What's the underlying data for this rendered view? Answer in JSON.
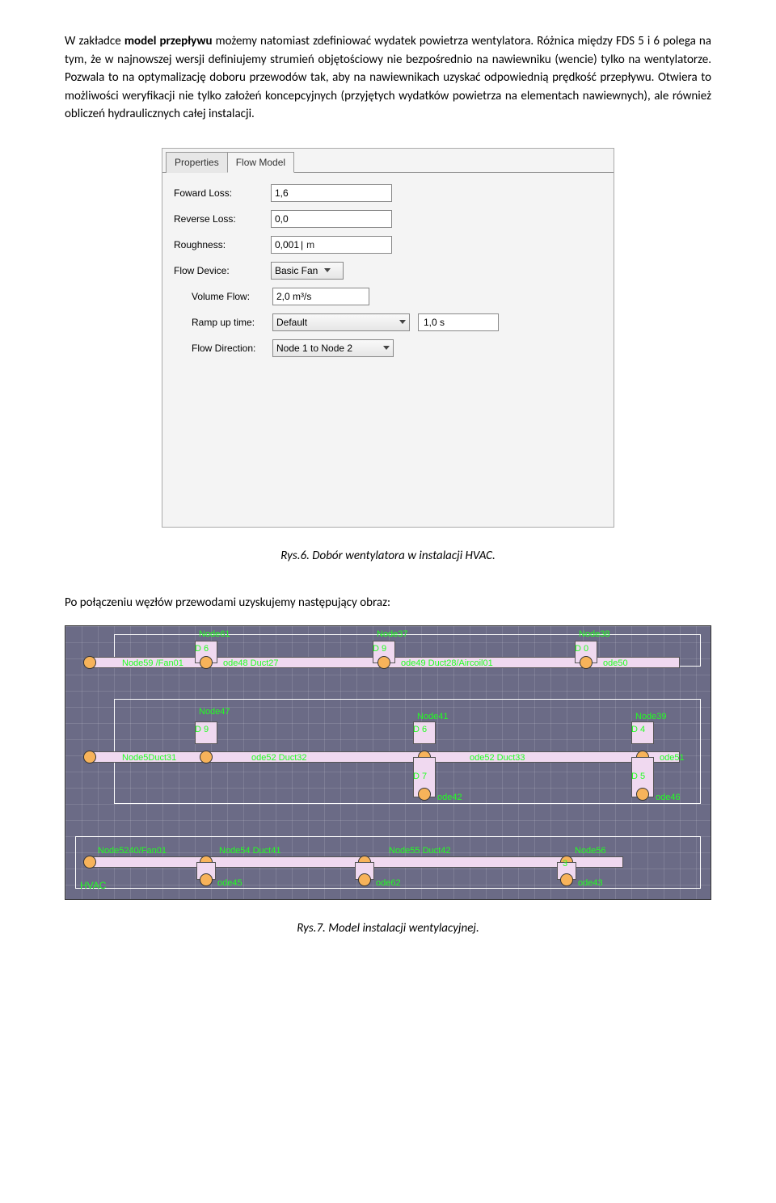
{
  "para1": {
    "pre": "W zakładce ",
    "b1": "model przepływu",
    "rest": " możemy natomiast zdefiniować wydatek powietrza wentylatora. Różnica między FDS 5 i 6 polega na tym, że w najnowszej wersji definiujemy strumień objętościowy nie bezpośrednio na nawiewniku (wencie) tylko na wentylatorze. Pozwala to na optymalizację doboru przewodów tak, aby na nawiewnikach uzyskać odpowiednią prędkość przepływu. Otwiera to możliwości weryfikacji nie tylko założeń koncepcyjnych (przyjętych wydatków powietrza na elementach nawiewnych), ale również obliczeń hydraulicznych całej instalacji."
  },
  "flowModel": {
    "tabs": {
      "properties": "Properties",
      "flowModel": "Flow Model"
    },
    "forwardLoss": {
      "label": "Foward Loss:",
      "value": "1,6"
    },
    "reverseLoss": {
      "label": "Reverse Loss:",
      "value": "0,0"
    },
    "roughness": {
      "label": "Roughness:",
      "value": "0,001",
      "unit": "m"
    },
    "flowDevice": {
      "label": "Flow Device:",
      "value": "Basic Fan"
    },
    "volumeFlow": {
      "label": "Volume Flow:",
      "value": "2,0 m³/s"
    },
    "rampUpTime": {
      "label": "Ramp up time:",
      "value": "Default",
      "seconds": "1,0 s"
    },
    "flowDirection": {
      "label": "Flow Direction:",
      "value": "Node 1 to Node 2"
    }
  },
  "caption1": "Rys.6. Dobór wentylatora w instalacji HVAC.",
  "para2": "Po połączeniu węzłów przewodami uzyskujemy następujący obraz:",
  "hvac": {
    "title": "HVAC",
    "row1": {
      "left": "Node59 /Fan01",
      "n61": "Node61",
      "d26": "D    6",
      "duct27l": "ode48  Duct27",
      "n37": "Node37",
      "d29": "D    9",
      "duct28": "ode49  Duct28/Aircoil01",
      "n38": "Node38",
      "d30": "D    0",
      "n50": "ode50"
    },
    "row2": {
      "left": "Node5Duct31",
      "n47": "Node47",
      "d29b": "D    9",
      "mid": "ode52   Duct32",
      "n41": "Node41",
      "d26b": "D    6",
      "right": "ode52   Duct33",
      "n39": "Node39",
      "d24": "D    4",
      "n51": "ode51",
      "d27": "D    7",
      "n42": "ode42",
      "d25": "D    5",
      "n46": "ode46"
    },
    "row3": {
      "left": "Node5240/Fan01",
      "r1": "Node54  Duct41",
      "r2": "Node55    Duct42",
      "r3": "Node56",
      "d3": "3",
      "n45": "ode45",
      "n62": "ode62",
      "n43": "ode43"
    }
  },
  "caption2": "Rys.7. Model instalacji wentylacyjnej."
}
